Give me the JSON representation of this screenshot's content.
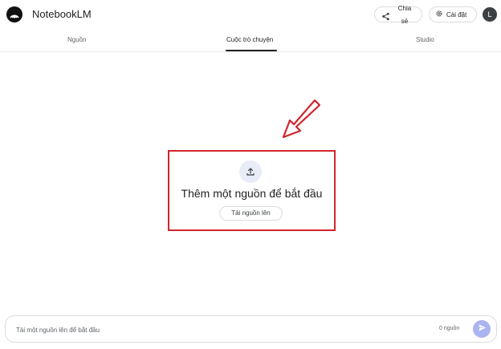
{
  "header": {
    "app_title": "NotebookLM",
    "share_label": "Chia sẻ",
    "settings_label": "Cài đặt",
    "avatar_letter": "L"
  },
  "tabs": [
    {
      "label": "Nguồn"
    },
    {
      "label": "Cuộc trò chuyện",
      "active": true
    },
    {
      "label": "Studio"
    }
  ],
  "empty_state": {
    "title": "Thêm một nguồn để bắt đầu",
    "upload_button": "Tải nguồn lên"
  },
  "chat_input": {
    "placeholder": "Tải một nguồn lên để bắt đầu",
    "source_count": "0 nguồn"
  },
  "colors": {
    "annotation_red": "#d0262d",
    "send_button": "#a9b4f0",
    "upload_circle": "#e8ecf7"
  },
  "icons": [
    "notebooklm-logo-icon",
    "share-icon",
    "gear-icon",
    "upload-icon",
    "send-icon",
    "arrow-annotation-icon"
  ]
}
